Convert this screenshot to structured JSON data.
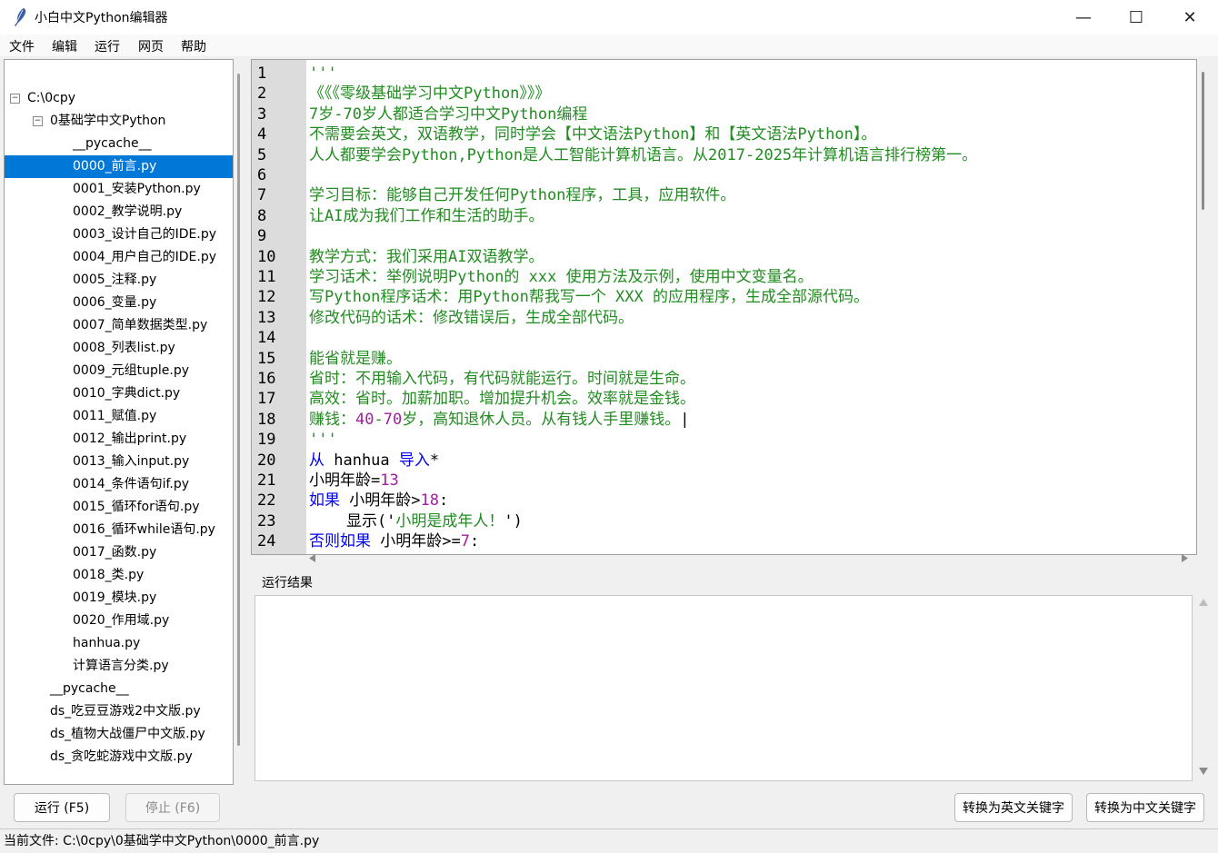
{
  "window": {
    "title": "小白中文Python编辑器",
    "minimize": "—",
    "maximize": "☐",
    "close": "✕"
  },
  "menu": [
    "文件",
    "编辑",
    "运行",
    "网页",
    "帮助"
  ],
  "tree": {
    "root": "C:\\0cpy",
    "folder": "0基础学中文Python",
    "folder_items": [
      "__pycache__",
      "0000_前言.py",
      "0001_安装Python.py",
      "0002_教学说明.py",
      "0003_设计自己的IDE.py",
      "0004_用户自己的IDE.py",
      "0005_注释.py",
      "0006_变量.py",
      "0007_简单数据类型.py",
      "0008_列表list.py",
      "0009_元组tuple.py",
      "0010_字典dict.py",
      "0011_赋值.py",
      "0012_输出print.py",
      "0013_输入input.py",
      "0014_条件语句if.py",
      "0015_循环for语句.py",
      "0016_循环while语句.py",
      "0017_函数.py",
      "0018_类.py",
      "0019_模块.py",
      "0020_作用域.py",
      "hanhua.py",
      "计算语言分类.py"
    ],
    "root_items": [
      "__pycache__",
      "ds_吃豆豆游戏2中文版.py",
      "ds_植物大战僵尸中文版.py",
      "ds_贪吃蛇游戏中文版.py"
    ],
    "selected": "0000_前言.py"
  },
  "editor": {
    "line_numbers": [
      "1",
      "2",
      "3",
      "4",
      "5",
      "6",
      "7",
      "8",
      "9",
      "10",
      "11",
      "12",
      "13",
      "14",
      "15",
      "16",
      "17",
      "18",
      "19",
      "20",
      "21",
      "22",
      "23",
      "24"
    ],
    "lines": [
      [
        {
          "t": "'''",
          "c": "g"
        }
      ],
      [
        {
          "t": "《《《零级基础学习中文Python》》》",
          "c": "g"
        }
      ],
      [
        {
          "t": "7岁-70岁人都适合学习中文Python编程",
          "c": "g"
        }
      ],
      [
        {
          "t": "不需要会英文，双语教学，同时学会【中文语法Python】和【英文语法Python】。",
          "c": "g"
        }
      ],
      [
        {
          "t": "人人都要学会Python,Python是人工智能计算机语言。从2017-2025年计算机语言排行榜第一。",
          "c": "g"
        }
      ],
      [
        {
          "t": "",
          "c": "g"
        }
      ],
      [
        {
          "t": "学习目标：能够自己开发任何Python程序，工具，应用软件。",
          "c": "g"
        }
      ],
      [
        {
          "t": "让AI成为我们工作和生活的助手。",
          "c": "g"
        }
      ],
      [
        {
          "t": "",
          "c": "g"
        }
      ],
      [
        {
          "t": "教学方式：我们采用AI双语教学。",
          "c": "g"
        }
      ],
      [
        {
          "t": "学习话术：举例说明Python的 xxx 使用方法及示例，使用中文变量名。",
          "c": "g"
        }
      ],
      [
        {
          "t": "写Python程序话术：用Python帮我写一个 XXX 的应用程序，生成全部源代码。",
          "c": "g"
        }
      ],
      [
        {
          "t": "修改代码的话术：修改错误后，生成全部代码。",
          "c": "g"
        }
      ],
      [
        {
          "t": "",
          "c": "g"
        }
      ],
      [
        {
          "t": "能省就是赚。",
          "c": "g"
        }
      ],
      [
        {
          "t": "省时：不用输入代码，有代码就能运行。时间就是生命。",
          "c": "g"
        }
      ],
      [
        {
          "t": "高效：省时。加薪加职。增加提升机会。效率就是金钱。",
          "c": "g"
        }
      ],
      [
        {
          "t": "赚钱：",
          "c": "g"
        },
        {
          "t": "40",
          "c": "p"
        },
        {
          "t": "-",
          "c": "g"
        },
        {
          "t": "70",
          "c": "p"
        },
        {
          "t": "岁，高知退休人员。从有钱人手里赚钱。",
          "c": "g"
        },
        {
          "t": "|",
          "c": "k"
        }
      ],
      [
        {
          "t": "'''",
          "c": "g"
        }
      ],
      [
        {
          "t": "从",
          "c": "b"
        },
        {
          "t": " hanhua ",
          "c": "k"
        },
        {
          "t": "导入",
          "c": "b"
        },
        {
          "t": "*",
          "c": "k"
        }
      ],
      [
        {
          "t": "小明年龄=",
          "c": "k"
        },
        {
          "t": "13",
          "c": "p"
        }
      ],
      [
        {
          "t": "如果",
          "c": "b"
        },
        {
          "t": " 小明年龄>",
          "c": "k"
        },
        {
          "t": "18",
          "c": "p"
        },
        {
          "t": ":",
          "c": "k"
        }
      ],
      [
        {
          "t": "    显示('",
          "c": "k"
        },
        {
          "t": "小明是成年人！",
          "c": "g"
        },
        {
          "t": "')",
          "c": "k"
        }
      ],
      [
        {
          "t": "否则如果",
          "c": "b"
        },
        {
          "t": " 小明年龄>=",
          "c": "k"
        },
        {
          "t": "7",
          "c": "p"
        },
        {
          "t": ":",
          "c": "k"
        }
      ]
    ]
  },
  "output": {
    "label": "运行结果"
  },
  "buttons": {
    "run": "运行 (F5)",
    "stop": "停止 (F6)",
    "to_english": "转换为英文关键字",
    "to_chinese": "转换为中文关键字"
  },
  "status": "当前文件: C:\\0cpy\\0基础学中文Python\\0000_前言.py"
}
